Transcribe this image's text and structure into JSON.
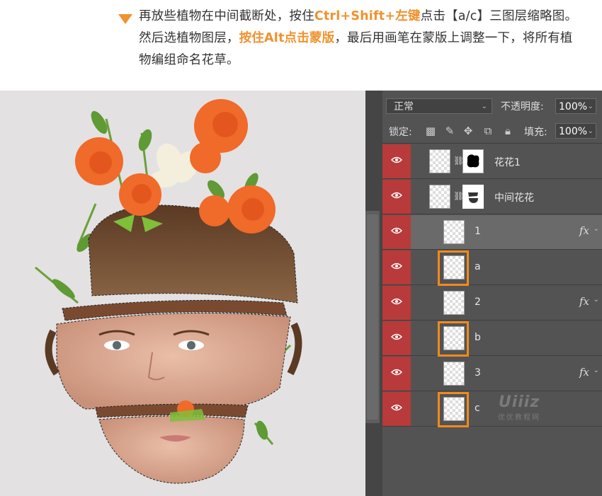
{
  "instruction": {
    "part1": "再放些植物在中间截断处，按住",
    "hl1": "Ctrl+Shift+左键",
    "part2": "点击【a/c】三图层缩略图。然后选植物图层，",
    "hl2": "按住Alt点击蒙版",
    "part3": "，最后用画笔在蒙版上调整一下，将所有植物编组命名花草。"
  },
  "panel": {
    "blend_mode": "正常",
    "opacity_label": "不透明度:",
    "opacity_value": "100%",
    "lock_label": "锁定:",
    "fill_label": "填充:",
    "fill_value": "100%",
    "lock_icons": [
      "checker-lock-icon",
      "brush-lock-icon",
      "move-lock-icon",
      "artboard-lock-icon",
      "padlock-icon"
    ]
  },
  "layers": [
    {
      "name": "花花1",
      "has_mask": true,
      "fx": "",
      "selected": false
    },
    {
      "name": "中间花花",
      "has_mask": true,
      "fx": "",
      "selected": false
    },
    {
      "name": "1",
      "has_mask": false,
      "fx": "fx",
      "selected": true
    },
    {
      "name": "a",
      "has_mask": false,
      "fx": "",
      "selected": false
    },
    {
      "name": "2",
      "has_mask": false,
      "fx": "fx",
      "selected": false
    },
    {
      "name": "b",
      "has_mask": false,
      "fx": "",
      "selected": false
    },
    {
      "name": "3",
      "has_mask": false,
      "fx": "fx",
      "selected": false
    },
    {
      "name": "c",
      "has_mask": false,
      "fx": "",
      "selected": false
    }
  ],
  "watermark": {
    "logo": "Uiiiz",
    "sub": "优优教程网"
  },
  "colors": {
    "accent": "#f0922e",
    "visibility": "#b83a3a",
    "panel": "#535353"
  }
}
